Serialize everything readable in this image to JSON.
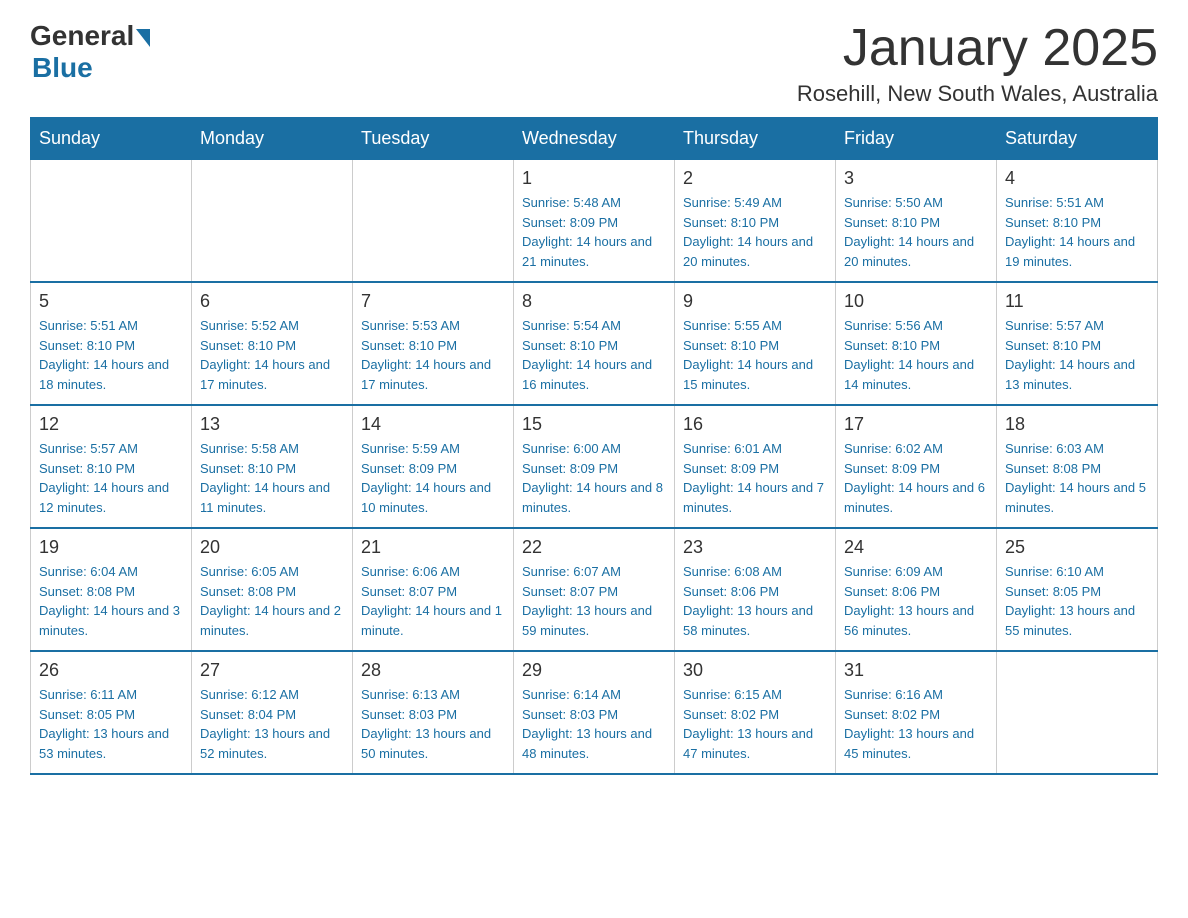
{
  "logo": {
    "general": "General",
    "blue": "Blue"
  },
  "header": {
    "month_title": "January 2025",
    "location": "Rosehill, New South Wales, Australia"
  },
  "days_of_week": [
    "Sunday",
    "Monday",
    "Tuesday",
    "Wednesday",
    "Thursday",
    "Friday",
    "Saturday"
  ],
  "weeks": [
    [
      {
        "day": "",
        "info": ""
      },
      {
        "day": "",
        "info": ""
      },
      {
        "day": "",
        "info": ""
      },
      {
        "day": "1",
        "info": "Sunrise: 5:48 AM\nSunset: 8:09 PM\nDaylight: 14 hours and 21 minutes."
      },
      {
        "day": "2",
        "info": "Sunrise: 5:49 AM\nSunset: 8:10 PM\nDaylight: 14 hours and 20 minutes."
      },
      {
        "day": "3",
        "info": "Sunrise: 5:50 AM\nSunset: 8:10 PM\nDaylight: 14 hours and 20 minutes."
      },
      {
        "day": "4",
        "info": "Sunrise: 5:51 AM\nSunset: 8:10 PM\nDaylight: 14 hours and 19 minutes."
      }
    ],
    [
      {
        "day": "5",
        "info": "Sunrise: 5:51 AM\nSunset: 8:10 PM\nDaylight: 14 hours and 18 minutes."
      },
      {
        "day": "6",
        "info": "Sunrise: 5:52 AM\nSunset: 8:10 PM\nDaylight: 14 hours and 17 minutes."
      },
      {
        "day": "7",
        "info": "Sunrise: 5:53 AM\nSunset: 8:10 PM\nDaylight: 14 hours and 17 minutes."
      },
      {
        "day": "8",
        "info": "Sunrise: 5:54 AM\nSunset: 8:10 PM\nDaylight: 14 hours and 16 minutes."
      },
      {
        "day": "9",
        "info": "Sunrise: 5:55 AM\nSunset: 8:10 PM\nDaylight: 14 hours and 15 minutes."
      },
      {
        "day": "10",
        "info": "Sunrise: 5:56 AM\nSunset: 8:10 PM\nDaylight: 14 hours and 14 minutes."
      },
      {
        "day": "11",
        "info": "Sunrise: 5:57 AM\nSunset: 8:10 PM\nDaylight: 14 hours and 13 minutes."
      }
    ],
    [
      {
        "day": "12",
        "info": "Sunrise: 5:57 AM\nSunset: 8:10 PM\nDaylight: 14 hours and 12 minutes."
      },
      {
        "day": "13",
        "info": "Sunrise: 5:58 AM\nSunset: 8:10 PM\nDaylight: 14 hours and 11 minutes."
      },
      {
        "day": "14",
        "info": "Sunrise: 5:59 AM\nSunset: 8:09 PM\nDaylight: 14 hours and 10 minutes."
      },
      {
        "day": "15",
        "info": "Sunrise: 6:00 AM\nSunset: 8:09 PM\nDaylight: 14 hours and 8 minutes."
      },
      {
        "day": "16",
        "info": "Sunrise: 6:01 AM\nSunset: 8:09 PM\nDaylight: 14 hours and 7 minutes."
      },
      {
        "day": "17",
        "info": "Sunrise: 6:02 AM\nSunset: 8:09 PM\nDaylight: 14 hours and 6 minutes."
      },
      {
        "day": "18",
        "info": "Sunrise: 6:03 AM\nSunset: 8:08 PM\nDaylight: 14 hours and 5 minutes."
      }
    ],
    [
      {
        "day": "19",
        "info": "Sunrise: 6:04 AM\nSunset: 8:08 PM\nDaylight: 14 hours and 3 minutes."
      },
      {
        "day": "20",
        "info": "Sunrise: 6:05 AM\nSunset: 8:08 PM\nDaylight: 14 hours and 2 minutes."
      },
      {
        "day": "21",
        "info": "Sunrise: 6:06 AM\nSunset: 8:07 PM\nDaylight: 14 hours and 1 minute."
      },
      {
        "day": "22",
        "info": "Sunrise: 6:07 AM\nSunset: 8:07 PM\nDaylight: 13 hours and 59 minutes."
      },
      {
        "day": "23",
        "info": "Sunrise: 6:08 AM\nSunset: 8:06 PM\nDaylight: 13 hours and 58 minutes."
      },
      {
        "day": "24",
        "info": "Sunrise: 6:09 AM\nSunset: 8:06 PM\nDaylight: 13 hours and 56 minutes."
      },
      {
        "day": "25",
        "info": "Sunrise: 6:10 AM\nSunset: 8:05 PM\nDaylight: 13 hours and 55 minutes."
      }
    ],
    [
      {
        "day": "26",
        "info": "Sunrise: 6:11 AM\nSunset: 8:05 PM\nDaylight: 13 hours and 53 minutes."
      },
      {
        "day": "27",
        "info": "Sunrise: 6:12 AM\nSunset: 8:04 PM\nDaylight: 13 hours and 52 minutes."
      },
      {
        "day": "28",
        "info": "Sunrise: 6:13 AM\nSunset: 8:03 PM\nDaylight: 13 hours and 50 minutes."
      },
      {
        "day": "29",
        "info": "Sunrise: 6:14 AM\nSunset: 8:03 PM\nDaylight: 13 hours and 48 minutes."
      },
      {
        "day": "30",
        "info": "Sunrise: 6:15 AM\nSunset: 8:02 PM\nDaylight: 13 hours and 47 minutes."
      },
      {
        "day": "31",
        "info": "Sunrise: 6:16 AM\nSunset: 8:02 PM\nDaylight: 13 hours and 45 minutes."
      },
      {
        "day": "",
        "info": ""
      }
    ]
  ]
}
